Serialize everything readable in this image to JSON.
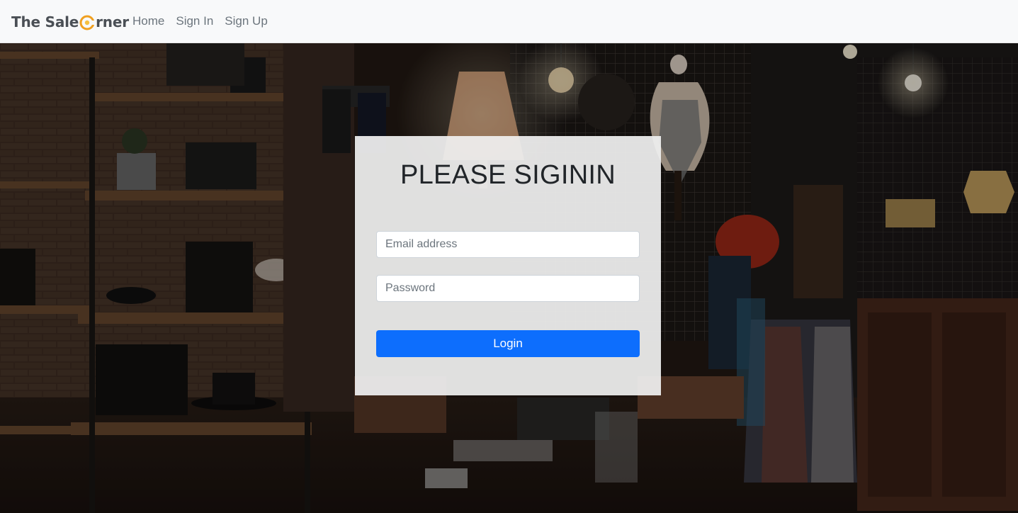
{
  "brand": {
    "prefix": "The Sale",
    "suffix": "rner",
    "accent_color": "#f0a020"
  },
  "nav": {
    "items": [
      {
        "label": "Home"
      },
      {
        "label": "Sign In"
      },
      {
        "label": "Sign Up"
      }
    ]
  },
  "login": {
    "title": "PLEASE SIGININ",
    "email_placeholder": "Email address",
    "password_placeholder": "Password",
    "button_label": "Login",
    "button_color": "#0d6efd"
  },
  "background": {
    "description_icon": "store-interior-photo"
  }
}
